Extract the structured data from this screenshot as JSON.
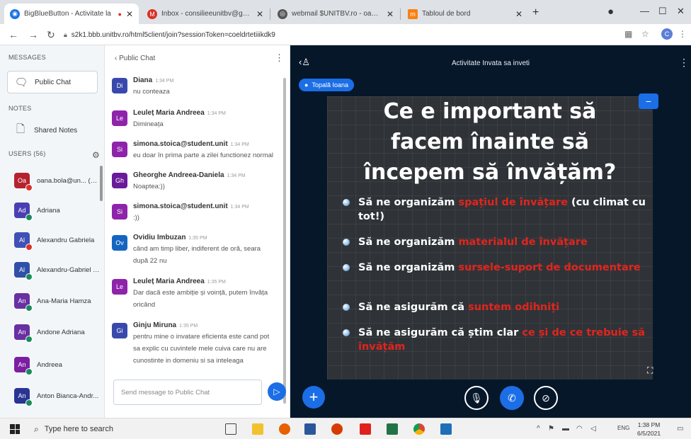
{
  "browser": {
    "tabs": [
      {
        "label": "BigBlueButton - Activitate la",
        "icon": "bbb-icon",
        "color": "#1a73e8",
        "active": true
      },
      {
        "label": "Inbox - consilieeunitbv@gmail.c",
        "icon": "gmail-icon",
        "color": "#d93025",
        "active": false
      },
      {
        "label": "webmail $UNITBV.ro - oana.bol",
        "icon": "webmail-icon",
        "color": "#555555",
        "active": false
      },
      {
        "label": "Tabloul de bord",
        "icon": "moodle-icon",
        "color": "#f98012",
        "active": false
      }
    ],
    "new_tab": "+",
    "window_controls": [
      "—",
      "☐",
      "✕"
    ],
    "url": "s2k1.bbb.unitbv.ro/html5client/join?sessionToken=coeldrtetiiikdk9",
    "profile_initial": "C"
  },
  "sidebar": {
    "messages_header": "MESSAGES",
    "public_chat_label": "Public Chat",
    "notes_header": "NOTES",
    "shared_notes_label": "Shared Notes",
    "users_header": "USERS (56)",
    "users": [
      {
        "initials": "Oa",
        "name": "oana.bola@un... (You)",
        "color": "#b5232e",
        "status": "#d9322b"
      },
      {
        "initials": "Ad",
        "name": "Adriana",
        "color": "#4a3fb2",
        "status": "#1a8a5c"
      },
      {
        "initials": "Al",
        "name": "Alexandru Gabriela",
        "color": "#3f51b5",
        "status": "#d9322b"
      },
      {
        "initials": "Al",
        "name": "Alexandru-Gabriel T...",
        "color": "#2f4fa8",
        "status": "#1a8a5c"
      },
      {
        "initials": "An",
        "name": "Ana-Maria Hamza",
        "color": "#6a2fa3",
        "status": "#1a8a5c"
      },
      {
        "initials": "An",
        "name": "Andone Adriana",
        "color": "#6a2fa3",
        "status": "#1a8a5c"
      },
      {
        "initials": "An",
        "name": "Andreea",
        "color": "#7b1fa2",
        "status": "#1a8a5c"
      },
      {
        "initials": "An",
        "name": "Anton Bianca-Andr...",
        "color": "#283593",
        "status": "#1a8a5c"
      }
    ]
  },
  "chat": {
    "header": "Public Chat",
    "messages": [
      {
        "initials": "Di",
        "name": "Diana",
        "time": "1:34 PM",
        "color": "#3949ab",
        "lines": [
          "nu conteaza"
        ]
      },
      {
        "initials": "Le",
        "name": "Leuleț Maria Andreea",
        "time": "1:34 PM",
        "color": "#8e24aa",
        "lines": [
          "Dimineața"
        ]
      },
      {
        "initials": "Si",
        "name": "simona.stoica@student.unit",
        "time": "1:34 PM",
        "color": "#8e24aa",
        "lines": [
          "eu doar în prima parte a zilei functionez normal"
        ]
      },
      {
        "initials": "Gh",
        "name": "Gheorghe Andreea-Daniela",
        "time": "1:34 PM",
        "color": "#6a1b9a",
        "lines": [
          "Noaptea:))"
        ]
      },
      {
        "initials": "Si",
        "name": "simona.stoica@student.unit",
        "time": "1:34 PM",
        "color": "#8e24aa",
        "lines": [
          ":))"
        ]
      },
      {
        "initials": "Ov",
        "name": "Ovidiu Imbuzan",
        "time": "1:35 PM",
        "color": "#1565c0",
        "lines": [
          "când am timp liber, indiferent de oră, seara",
          "după 22 nu"
        ]
      },
      {
        "initials": "Le",
        "name": "Leuleț Maria Andreea",
        "time": "1:35 PM",
        "color": "#8e24aa",
        "lines": [
          "Dar dacă este ambiție și voință, putem învăța",
          "oricând"
        ]
      },
      {
        "initials": "Gi",
        "name": "Ginju Miruna",
        "time": "1:35 PM",
        "color": "#3949ab",
        "lines": [
          "pentru mine o invatare eficienta este cand pot",
          "sa explic cu cuvintele mele cuiva care nu are",
          "cunostinte in domeniu si sa inteleaga"
        ]
      }
    ],
    "input_placeholder": "Send message to Public Chat"
  },
  "stage": {
    "title": "Activitate Invata sa inveti",
    "presenter": "Topală Ioana",
    "slide": {
      "title_lines": [
        "Ce e important să",
        "facem înainte să",
        "începem să învățăm?"
      ],
      "bullets": [
        {
          "plain": "Să ne organizăm ",
          "highlight": "spațiul de învățare",
          "tail": " (cu climat cu tot!)"
        },
        {
          "plain": "Să ne organizăm ",
          "highlight": "materialul de învățare",
          "tail": ""
        },
        {
          "plain": "Să ne organizăm ",
          "highlight": "sursele-suport de documentare",
          "tail": ""
        },
        {
          "plain": "Să ne asigurăm că ",
          "highlight": "suntem odihniți",
          "tail": ""
        },
        {
          "plain": "Să ne asigurăm că știm clar ",
          "highlight": "ce și de ce trebuie să învățăm",
          "tail": ""
        }
      ]
    },
    "colors": {
      "accent": "#1b6ee6",
      "highlight": "#e3241c",
      "stage_bg": "#06172a"
    }
  },
  "taskbar": {
    "search_placeholder": "Type here to search",
    "apps": [
      "task-view-icon",
      "file-explorer-icon",
      "firefox-icon",
      "word-icon",
      "office-icon",
      "acrobat-icon",
      "excel-icon",
      "chrome-icon",
      "photos-icon"
    ],
    "language": "ENG",
    "time": "1:38 PM",
    "date": "6/5/2021"
  }
}
